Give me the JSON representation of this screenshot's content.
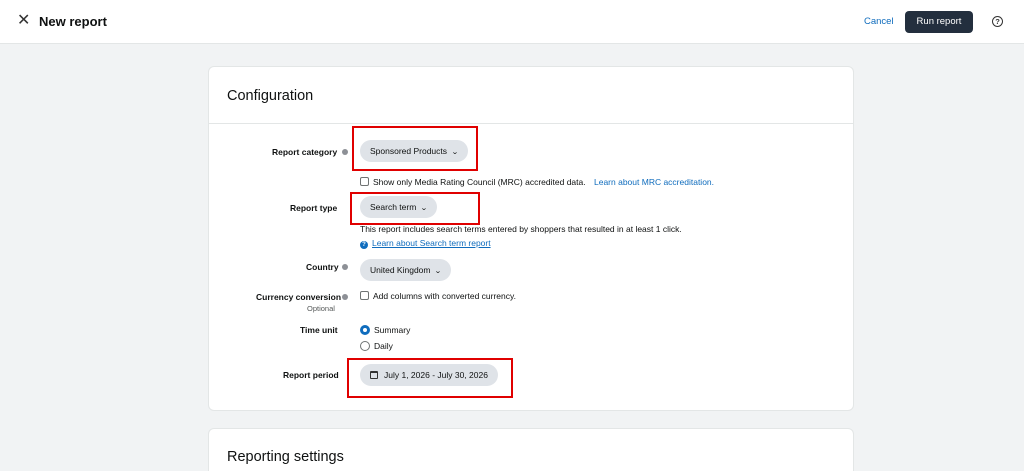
{
  "header": {
    "close_glyph": "✕",
    "title": "New report",
    "cancel_label": "Cancel",
    "run_label": "Run report",
    "help_glyph": "?"
  },
  "configuration": {
    "title": "Configuration",
    "report_category": {
      "label": "Report category",
      "value": "Sponsored Products",
      "mrc_text": "Show only Media Rating Council (MRC) accredited data.",
      "mrc_link": "Learn about MRC accreditation."
    },
    "report_type": {
      "label": "Report type",
      "value": "Search term",
      "description": "This report includes search terms entered by shoppers that resulted in at least 1 click.",
      "link": "Learn about Search term report",
      "link_icon_glyph": "?"
    },
    "country": {
      "label": "Country",
      "value": "United Kingdom"
    },
    "currency_conversion": {
      "label": "Currency conversion",
      "sublabel": "Optional",
      "checkbox_text": "Add columns with converted currency."
    },
    "time_unit": {
      "label": "Time unit",
      "options": [
        "Summary",
        "Daily"
      ],
      "selected": "Summary"
    },
    "report_period": {
      "label": "Report period",
      "value": "July 1, 2026 - July 30, 2026"
    }
  },
  "reporting_settings": {
    "title": "Reporting settings"
  },
  "chevron_glyph": "⌄",
  "colors": {
    "primary_button": "#232f3e",
    "link": "#0f6cbd",
    "highlight": "#e00000",
    "pill": "#dfe3e8"
  }
}
